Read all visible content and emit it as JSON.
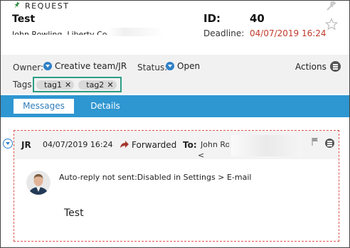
{
  "header": {
    "type_label": "REQUEST",
    "title": "Test",
    "subtitle": "John Rowling, Liberty Communications",
    "id_label": "ID:",
    "id_value": "40",
    "deadline_label": "Deadline:",
    "deadline_value": "04/07/2019 16:24"
  },
  "properties": {
    "owner_label": "Owner:",
    "owner_value": "Creative team/JR",
    "status_label": "Status:",
    "status_value": "Open",
    "actions_label": "Actions",
    "tags_label": "Tags:",
    "tags": [
      {
        "label": "tag1",
        "remove": "✕"
      },
      {
        "label": "tag2",
        "remove": "✕"
      }
    ]
  },
  "tabs": [
    {
      "label": "Messages",
      "active": true
    },
    {
      "label": "Details",
      "active": false
    }
  ],
  "message": {
    "sender": "JR",
    "date": "04/07/2019 16:24",
    "action": "Forwarded",
    "to_label": "To:",
    "to_value": "John Rowling",
    "to_value2": "<",
    "autoreply": "Auto-reply not sent:Disabled in Settings > E-mail",
    "body": "Test"
  },
  "colors": {
    "accent": "#2e96d1",
    "deadline": "#c0392b",
    "tag_highlight": "#2e9d84",
    "message_border": "#d9534f"
  },
  "icons": {
    "type": "pin-icon",
    "tool": "wrench-icon",
    "star": "star-icon",
    "dropdown": "chevron-down-circle-icon",
    "actions": "menu-circle-icon",
    "forward": "forward-arrow-icon",
    "flag": "flag-icon",
    "expand": "expand-circle-icon"
  }
}
